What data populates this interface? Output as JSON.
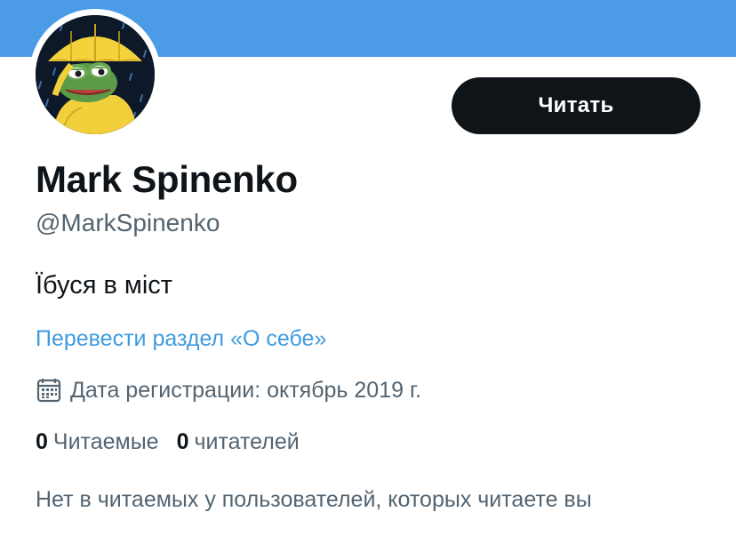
{
  "profile": {
    "display_name": "Mark Spinenko",
    "handle": "@MarkSpinenko",
    "bio": "Їбуся в міст",
    "translate_label": "Перевести раздел «О себе»",
    "joined": "Дата регистрации: октябрь 2019 г.",
    "follow_label": "Читать",
    "avatar_icon": "pepe-frog-umbrella-avatar",
    "calendar_icon": "calendar-icon"
  },
  "stats": {
    "following_count": "0",
    "following_label": "Читаемые",
    "followers_count": "0",
    "followers_label": "читателей"
  },
  "mutual_note": "Нет в читаемых у пользователей, которых читаете вы",
  "colors": {
    "banner": "#4b9be6",
    "button_bg": "#0f1419",
    "link": "#3f9be0",
    "secondary_text": "#536471"
  }
}
